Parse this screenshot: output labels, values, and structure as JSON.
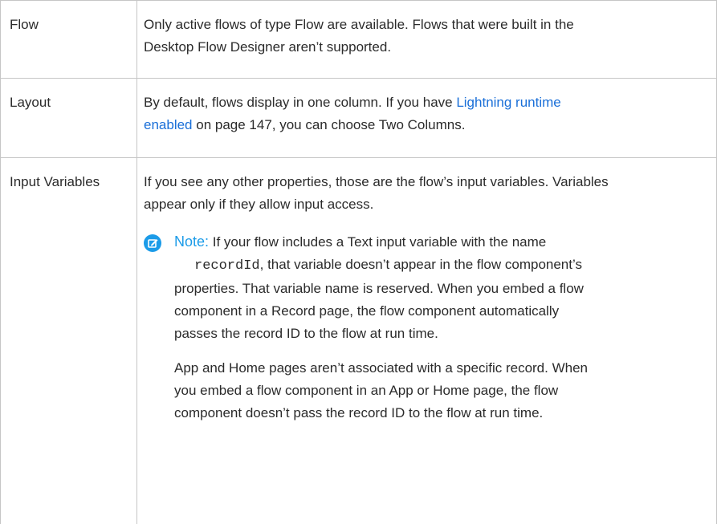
{
  "rows": [
    {
      "name": "Flow",
      "lines": [
        "Only active flows of type Flow are available. Flows that were built in the",
        "Desktop Flow Designer aren’t supported."
      ]
    },
    {
      "name": "Layout",
      "line1_before": "By default, flows display in one column. If you have ",
      "link_line1": "Lightning runtime",
      "link_line2": "enabled",
      "line2_after": " on page 147, you can choose Two Columns."
    },
    {
      "name": "Input Variables",
      "lines": [
        "If you see any other properties, those are the flow’s input variables. Variables",
        "appear only if they allow input access."
      ],
      "note": {
        "label": "Note:",
        "line1": " If your flow includes a Text input variable with the name",
        "code": "recordId",
        "line2_after": ", that variable doesn’t appear in the flow component’s",
        "lines_rest": [
          "properties. That variable name is reserved. When you embed a flow",
          "component in a Record page, the flow component automatically",
          "passes the record ID to the flow at run time."
        ],
        "para2": [
          "App and Home pages aren’t associated with a specific record. When",
          "you embed a flow component in an App or Home page, the flow",
          "component doesn’t pass the record ID to the flow at run time."
        ]
      }
    }
  ],
  "colors": {
    "link": "#1a6fd8",
    "note_accent": "#1b9be8",
    "border": "#c6c6c6"
  },
  "icons": {
    "note": "edit-note-icon"
  }
}
